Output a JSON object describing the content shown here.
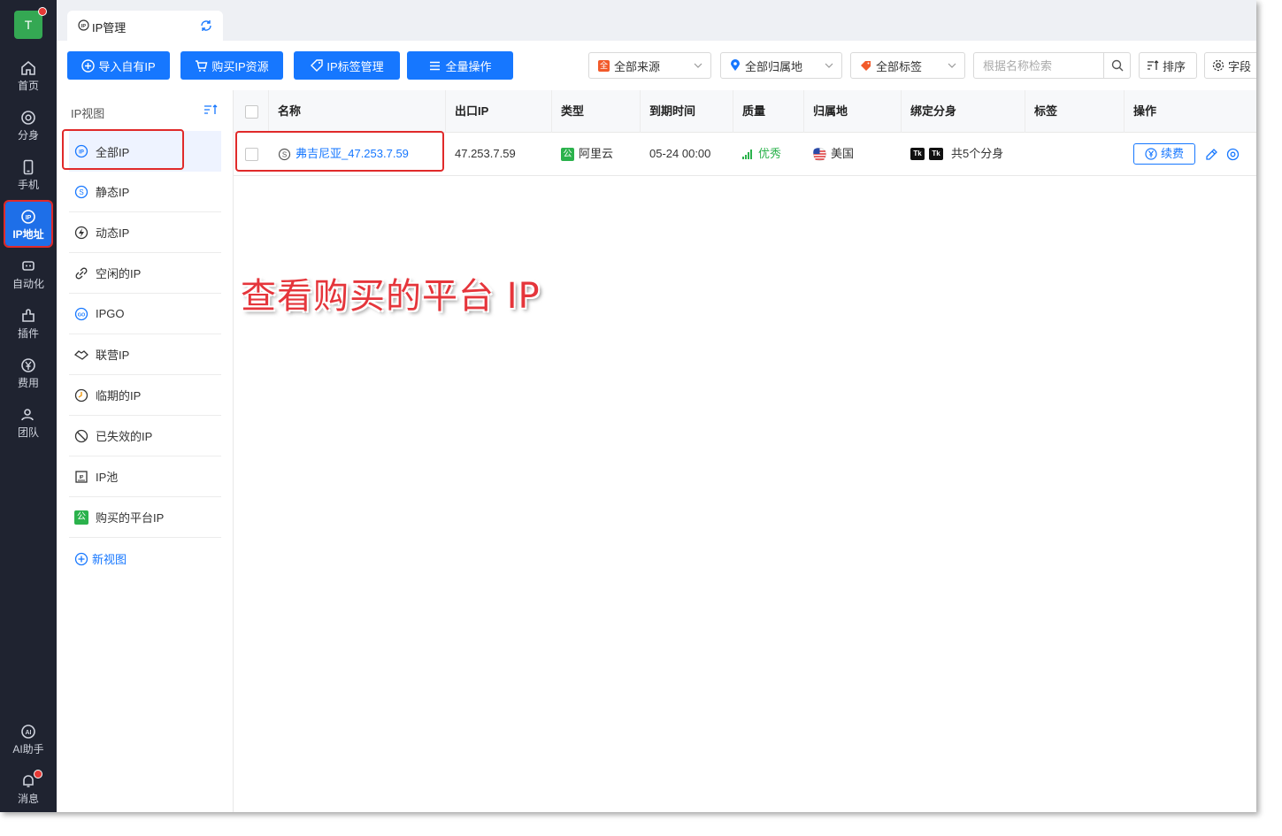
{
  "leftnav": {
    "avatar_letter": "T",
    "items": [
      {
        "label": "首页",
        "icon": "home-icon"
      },
      {
        "label": "分身",
        "icon": "chrome-icon"
      },
      {
        "label": "手机",
        "icon": "phone-icon"
      },
      {
        "label": "IP地址",
        "icon": "ip-icon"
      },
      {
        "label": "自动化",
        "icon": "robot-icon"
      },
      {
        "label": "插件",
        "icon": "puzzle-icon"
      },
      {
        "label": "费用",
        "icon": "yen-icon"
      },
      {
        "label": "团队",
        "icon": "team-icon"
      }
    ],
    "ai_label": "AI助手",
    "msg_label": "消息"
  },
  "tab": {
    "label": "IP管理"
  },
  "toolbar": {
    "import_label": "导入自有IP",
    "buy_label": "购买IP资源",
    "tag_label": "IP标签管理",
    "batch_label": "全量操作",
    "source_select": "全部来源",
    "region_select": "全部归属地",
    "tag_select": "全部标签",
    "search_placeholder": "根据名称检索",
    "sort_label": "排序",
    "settings_label": "字段"
  },
  "views": {
    "header": "IP视图",
    "items": [
      {
        "label": "全部IP",
        "icon": "ip-icon"
      },
      {
        "label": "静态IP",
        "icon": "static-icon"
      },
      {
        "label": "动态IP",
        "icon": "bolt-icon"
      },
      {
        "label": "空闲的IP",
        "icon": "link-icon"
      },
      {
        "label": "IPGO",
        "icon": "go-icon"
      },
      {
        "label": "联营IP",
        "icon": "handshake-icon"
      },
      {
        "label": "临期的IP",
        "icon": "clock-icon"
      },
      {
        "label": "已失效的IP",
        "icon": "disabled-icon"
      },
      {
        "label": "IP池",
        "icon": "pool-icon"
      },
      {
        "label": "购买的平台IP",
        "icon": "platform-icon"
      }
    ],
    "new_view": "新视图"
  },
  "table": {
    "columns": [
      "名称",
      "出口IP",
      "类型",
      "到期时间",
      "质量",
      "归属地",
      "绑定分身",
      "标签",
      "操作"
    ],
    "rows": [
      {
        "name": "弗吉尼亚_47.253.7.59",
        "ip": "47.253.7.59",
        "type_badge": "公",
        "type": "阿里云",
        "expire": "05-24 00:00",
        "quality": "优秀",
        "region": "美国",
        "bound_tag_1": "Tk",
        "bound_tag_2": "Tk",
        "bound": "共5个分身",
        "renew": "续费"
      }
    ]
  },
  "annotation": "查看购买的平台 IP",
  "colors": {
    "primary": "#1677ff",
    "nav_bg": "#1f2330",
    "highlight": "#e02a2a",
    "good": "#2bb24c"
  }
}
